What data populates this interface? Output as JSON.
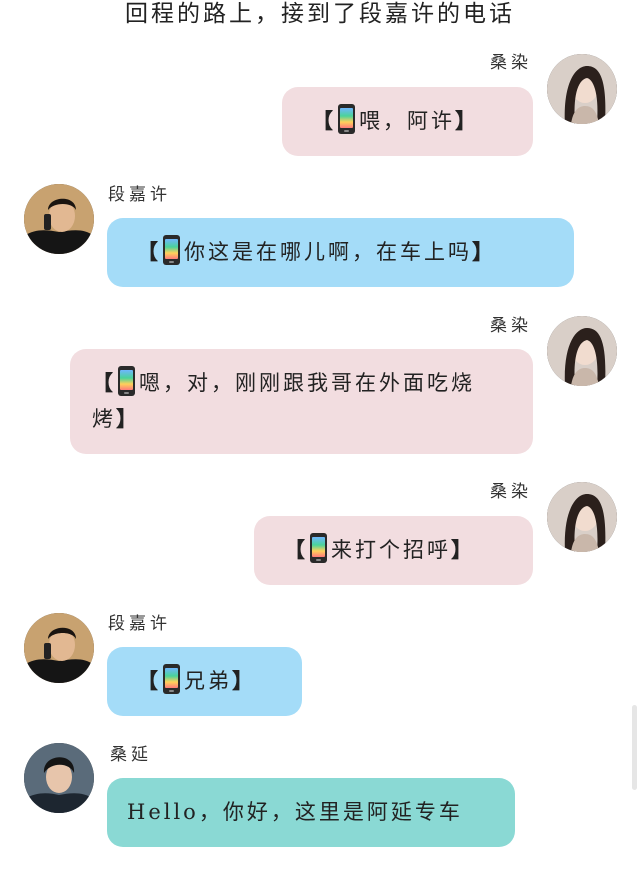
{
  "scene": {
    "title": "回程的路上，接到了段嘉许的电话"
  },
  "icons": {
    "phone": "phone-emoji-icon"
  },
  "colors": {
    "pink_bubble": "#f2dde0",
    "blue_bubble": "#a4dcf8",
    "teal_bubble": "#8ad9d4"
  },
  "messages": [
    {
      "sender": "桑染",
      "side": "right",
      "bracket_open": "【",
      "text": "喂，阿许",
      "bracket_close": "】"
    },
    {
      "sender": "段嘉许",
      "side": "left",
      "bracket_open": "【",
      "text": "你这是在哪儿啊，在车上吗",
      "bracket_close": "】"
    },
    {
      "sender": "桑染",
      "side": "right",
      "bracket_open": "【",
      "text": "嗯，对，刚刚跟我哥在外面吃烧烤",
      "bracket_close": "】"
    },
    {
      "sender": "桑染",
      "side": "right",
      "bracket_open": "【",
      "text": "来打个招呼",
      "bracket_close": "】"
    },
    {
      "sender": "段嘉许",
      "side": "left",
      "bracket_open": "【",
      "text": "兄弟",
      "bracket_close": "】"
    },
    {
      "sender": "桑延",
      "side": "left",
      "text": "Hello，你好，这里是阿延专车"
    }
  ]
}
